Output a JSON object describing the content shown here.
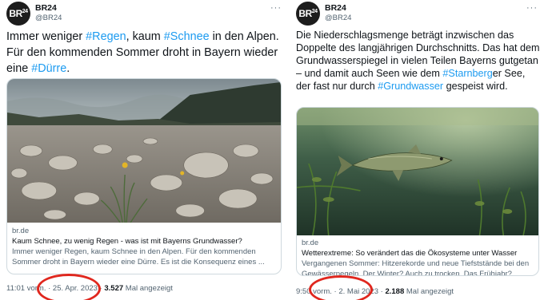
{
  "colors": {
    "link": "#1d9bf0",
    "text": "#0f1419",
    "secondary": "#536471",
    "border": "#cfd9de",
    "highlight_circle": "#e0271e"
  },
  "tweets": [
    {
      "avatar": {
        "icon": "br24-logo",
        "text": "BR",
        "sup": "24"
      },
      "name": "BR24",
      "handle": "@BR24",
      "more": "···",
      "text": [
        {
          "t": "Immer weniger ",
          "tag": false
        },
        {
          "t": "#Regen",
          "tag": true
        },
        {
          "t": ", kaum ",
          "tag": false
        },
        {
          "t": "#Schnee",
          "tag": true
        },
        {
          "t": " in den Alpen. Für den kommenden Sommer droht in Bayern wieder eine ",
          "tag": false
        },
        {
          "t": "#Dürre",
          "tag": true
        },
        {
          "t": ".",
          "tag": false
        }
      ],
      "card": {
        "image": "dry-alpine-riverbed-photo",
        "domain": "br.de",
        "title": "Kaum Schnee, zu wenig Regen - was ist mit Bayerns Grundwasser?",
        "description": "Immer weniger Regen, kaum Schnee in den Alpen. Für den kommenden Sommer droht in Bayern wieder eine Dürre. Es ist die Konsequenz eines ..."
      },
      "meta": {
        "time": "11:01 vorm.",
        "date": "25. Apr. 2023",
        "views": "3.527",
        "views_label": "Mal angezeigt"
      }
    },
    {
      "avatar": {
        "icon": "br24-logo",
        "text": "BR",
        "sup": "24"
      },
      "name": "BR24",
      "handle": "@BR24",
      "more": "···",
      "text": [
        {
          "t": "Die Niederschlagsmenge beträgt inzwischen das Doppelte des langjährigen Durchschnitts. Das hat dem Grundwasserspiegel in vielen Teilen Bayerns gutgetan – und damit auch Seen wie dem ",
          "tag": false
        },
        {
          "t": "#Starnberg",
          "tag": true
        },
        {
          "t": "er See, der fast nur durch ",
          "tag": false
        },
        {
          "t": "#Grundwasser",
          "tag": true
        },
        {
          "t": " gespeist wird.",
          "tag": false
        }
      ],
      "card": {
        "image": "underwater-pike-photo",
        "domain": "br.de",
        "title": "Wetterextreme: So verändert das die Ökosysteme unter Wasser",
        "description": "Vergangenen Sommer: Hitzerekorde und neue Tiefststände bei den Gewässerpegeln. Der Winter? Auch zu trocken. Das Frühjahr? Feucht und küh..."
      },
      "meta": {
        "time": "9:50 vorm.",
        "date": "2. Mai 2023",
        "views": "2.188",
        "views_label": "Mal angezeigt"
      }
    }
  ]
}
